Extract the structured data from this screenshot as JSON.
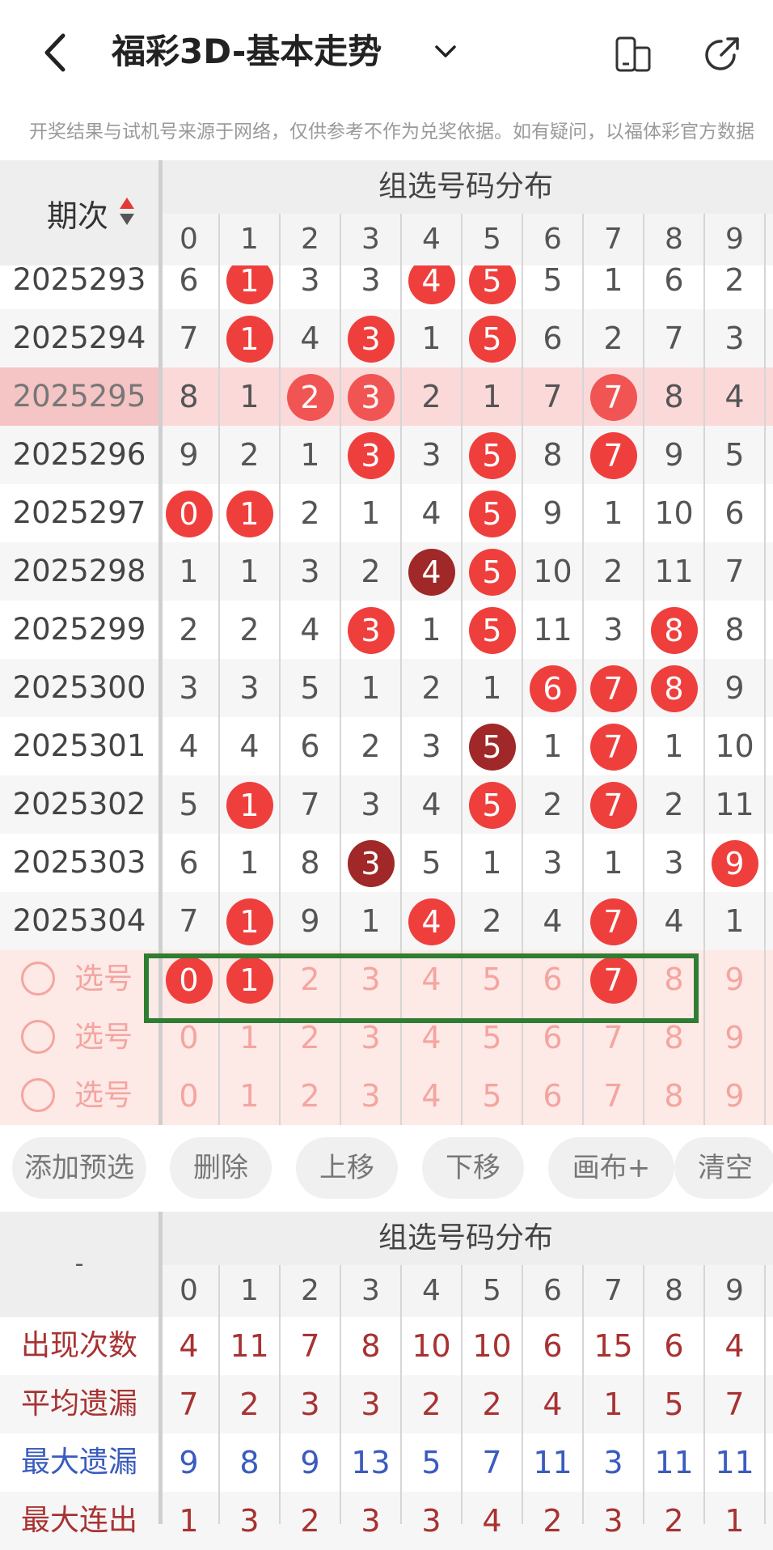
{
  "header": {
    "title": "福彩3D-基本走势",
    "back_icon": "chevron-left-icon",
    "dropdown_icon": "chevron-down-icon",
    "icon_left": "phone-layout-icon",
    "icon_right": "share-arrow-icon"
  },
  "notice": "开奖结果与试机号来源于网络，仅供参考不作为兑奖依据。如有疑问，以福体彩官方数据",
  "table": {
    "period_header": "期次",
    "group_header": "组选号码分布",
    "digits": [
      "0",
      "1",
      "2",
      "3",
      "4",
      "5",
      "6",
      "7",
      "8",
      "9"
    ],
    "rows": [
      {
        "period": "2025293",
        "cells": [
          "6",
          "1",
          "3",
          "3",
          "4",
          "5",
          "5",
          "1",
          "6",
          "2"
        ],
        "balls": [
          "",
          "r",
          "",
          "",
          "r",
          "r",
          "",
          "",
          "",
          ""
        ]
      },
      {
        "period": "2025294",
        "cells": [
          "7",
          "1",
          "4",
          "3",
          "1",
          "5",
          "6",
          "2",
          "7",
          "3"
        ],
        "balls": [
          "",
          "r",
          "",
          "r",
          "",
          "r",
          "",
          "",
          "",
          ""
        ]
      },
      {
        "period": "2025295",
        "cells": [
          "8",
          "1",
          "2",
          "3",
          "2",
          "1",
          "7",
          "7",
          "8",
          "4"
        ],
        "balls": [
          "",
          "",
          "r",
          "r",
          "",
          "",
          "",
          "r",
          "",
          ""
        ],
        "highlight": true
      },
      {
        "period": "2025296",
        "cells": [
          "9",
          "2",
          "1",
          "3",
          "3",
          "5",
          "8",
          "7",
          "9",
          "5"
        ],
        "balls": [
          "",
          "",
          "",
          "r",
          "",
          "r",
          "",
          "r",
          "",
          ""
        ]
      },
      {
        "period": "2025297",
        "cells": [
          "0",
          "1",
          "2",
          "1",
          "4",
          "5",
          "9",
          "1",
          "10",
          "6"
        ],
        "balls": [
          "r",
          "r",
          "",
          "",
          "",
          "r",
          "",
          "",
          "",
          ""
        ]
      },
      {
        "period": "2025298",
        "cells": [
          "1",
          "1",
          "3",
          "2",
          "4",
          "5",
          "10",
          "2",
          "11",
          "7"
        ],
        "balls": [
          "",
          "",
          "",
          "",
          "d",
          "r",
          "",
          "",
          "",
          ""
        ]
      },
      {
        "period": "2025299",
        "cells": [
          "2",
          "2",
          "4",
          "3",
          "1",
          "5",
          "11",
          "3",
          "8",
          "8"
        ],
        "balls": [
          "",
          "",
          "",
          "r",
          "",
          "r",
          "",
          "",
          "r",
          ""
        ]
      },
      {
        "period": "2025300",
        "cells": [
          "3",
          "3",
          "5",
          "1",
          "2",
          "1",
          "6",
          "7",
          "8",
          "9"
        ],
        "balls": [
          "",
          "",
          "",
          "",
          "",
          "",
          "r",
          "r",
          "r",
          ""
        ]
      },
      {
        "period": "2025301",
        "cells": [
          "4",
          "4",
          "6",
          "2",
          "3",
          "5",
          "1",
          "7",
          "1",
          "10"
        ],
        "balls": [
          "",
          "",
          "",
          "",
          "",
          "d",
          "",
          "r",
          "",
          ""
        ]
      },
      {
        "period": "2025302",
        "cells": [
          "5",
          "1",
          "7",
          "3",
          "4",
          "5",
          "2",
          "7",
          "2",
          "11"
        ],
        "balls": [
          "",
          "r",
          "",
          "",
          "",
          "r",
          "",
          "r",
          "",
          ""
        ]
      },
      {
        "period": "2025303",
        "cells": [
          "6",
          "1",
          "8",
          "3",
          "5",
          "1",
          "3",
          "1",
          "3",
          "9"
        ],
        "balls": [
          "",
          "",
          "",
          "d",
          "",
          "",
          "",
          "",
          "",
          "r"
        ]
      },
      {
        "period": "2025304",
        "cells": [
          "7",
          "1",
          "9",
          "1",
          "4",
          "2",
          "4",
          "7",
          "4",
          "1"
        ],
        "balls": [
          "",
          "r",
          "",
          "",
          "r",
          "",
          "",
          "r",
          "",
          ""
        ]
      }
    ],
    "select_rows": [
      {
        "label": "选号",
        "balls": [
          "r",
          "r",
          "",
          "",
          "",
          "",
          "",
          "r",
          "",
          ""
        ]
      },
      {
        "label": "选号",
        "balls": [
          "",
          "",
          "",
          "",
          "",
          "",
          "",
          "",
          "",
          ""
        ]
      },
      {
        "label": "选号",
        "balls": [
          "",
          "",
          "",
          "",
          "",
          "",
          "",
          "",
          "",
          ""
        ]
      }
    ]
  },
  "buttons": [
    "添加预选",
    "删除",
    "上移",
    "下移",
    "画布+",
    "清空"
  ],
  "stats": {
    "corner": "-",
    "group_header": "组选号码分布",
    "rows": [
      {
        "label": "出现次数",
        "color": "#a83232",
        "values": [
          "4",
          "11",
          "7",
          "8",
          "10",
          "10",
          "6",
          "15",
          "6",
          "4"
        ]
      },
      {
        "label": "平均遗漏",
        "color": "#a83232",
        "values": [
          "7",
          "2",
          "3",
          "3",
          "2",
          "2",
          "4",
          "1",
          "5",
          "7"
        ]
      },
      {
        "label": "最大遗漏",
        "color": "#3a5bbf",
        "values": [
          "9",
          "8",
          "9",
          "13",
          "5",
          "7",
          "11",
          "3",
          "11",
          "11"
        ]
      },
      {
        "label": "最大连出",
        "color": "#a83232",
        "values": [
          "1",
          "3",
          "2",
          "3",
          "3",
          "4",
          "2",
          "3",
          "2",
          "1"
        ]
      }
    ]
  },
  "colors": {
    "ball_red": "#ef3f3d",
    "ball_dark": "#a02828",
    "select_outline": "#2e7d32"
  }
}
